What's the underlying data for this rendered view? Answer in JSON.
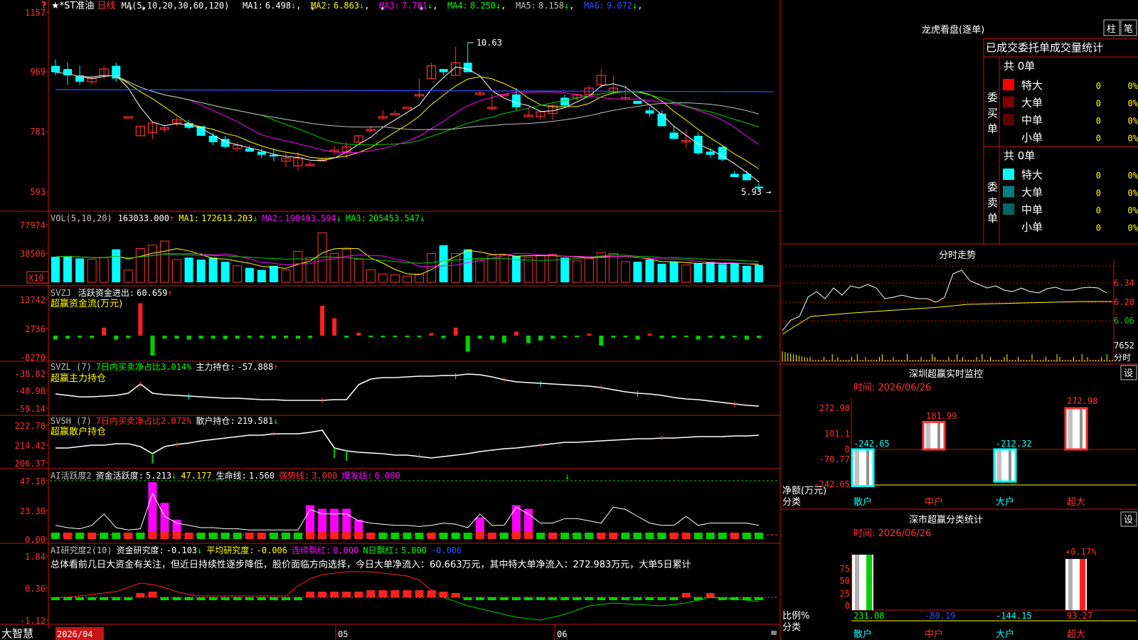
{
  "colors": {
    "red": "#ff3232",
    "cyan": "#00ffff",
    "white": "#ffffff",
    "yellow": "#ffff00",
    "magenta": "#ff00ff",
    "green": "#00d000",
    "blue": "#3050ff",
    "frame": "#c81414",
    "gray": "#c0c0c0"
  },
  "corner_icon": "?",
  "header": {
    "name": "★*ST准油",
    "period": "日线",
    "ma_spec": "MA(5,10,20,30,60,120)",
    "ma": [
      {
        "label": "MA1:",
        "value": "6.498",
        "arrow": "↓",
        "color": "#ffffff"
      },
      {
        "label": "MA2:",
        "value": "6.863",
        "arrow": "↓",
        "color": "#ffff00"
      },
      {
        "label": "MA3:",
        "value": "7.781",
        "arrow": "↓",
        "color": "#ff00ff"
      },
      {
        "label": "MA4:",
        "value": "8.250",
        "arrow": "↓",
        "color": "#00ff00"
      },
      {
        "label": "MA5:",
        "value": "8.158",
        "arrow": "↓",
        "color": "#c0c0c0"
      },
      {
        "label": "MA6:",
        "value": "9.072",
        "arrow": "↓",
        "color": "#3050ff"
      }
    ]
  },
  "price_axis": [
    "1157",
    "969",
    "781",
    "593"
  ],
  "price_high_label": "10.63",
  "price_low_label": "5.93",
  "vol_panel": {
    "title": "VOL(5,10,20)",
    "value": "163033.000",
    "arrow": "↑",
    "ma": [
      {
        "label": "MA1:",
        "value": "172613.203",
        "arrow": "↓",
        "color": "#ffff00"
      },
      {
        "label": "MA2:",
        "value": "190493.594",
        "arrow": "↓",
        "color": "#ff00ff"
      },
      {
        "label": "MA3:",
        "value": "205453.547",
        "arrow": "↓",
        "color": "#00ff00"
      }
    ],
    "axis": [
      "77974",
      "38506"
    ],
    "unit": "X10"
  },
  "svzj_panel": {
    "title": "SVZJ",
    "label": "活跃资金进出:",
    "value": "60.659",
    "arrow": "↑",
    "subtitle": "超赢资金流(万元)",
    "axis": [
      "13742",
      "2736",
      "-8270"
    ]
  },
  "svzl_panel": {
    "title": "SVZL (7)",
    "label1": "7日内买卖净占比3.014%",
    "label2": "主力持仓:",
    "value": "-57.888",
    "arrow": "↑",
    "subtitle": "超赢主力持仓",
    "axis": [
      "-38.82",
      "-48.98",
      "-59.14"
    ]
  },
  "svsh_panel": {
    "title": "SVSH (7)",
    "label1": "7日内买卖净占比2.072%",
    "label2": "散户持仓:",
    "value": "219.581",
    "arrow": "↓",
    "subtitle": "超赢散户持仓",
    "axis": [
      "222.78",
      "214.42",
      "206.37"
    ]
  },
  "ai_panel": {
    "title": "AI活跃度2",
    "label": "资金活跃度:",
    "value": "5.213",
    "arrow": "↓",
    "v2": "47.177",
    "label3": "生命线:",
    "v3": "1.560",
    "label4": "强势线:",
    "v4": "3.000",
    "label5": "爆发线:",
    "v5": "6.000",
    "axis": [
      "47.18",
      "23.30",
      "0.00"
    ]
  },
  "ai2_panel": {
    "title": "AI研究度2(10)",
    "label": "资金研究度:",
    "value": "-0.103",
    "arrow": "↓",
    "label2": "平均研究度:",
    "v2": "-0.006",
    "label3": "连续飘红:",
    "v3": "0.000",
    "label4": "N日飘红:",
    "v4": "5.000",
    "v5": "-0.006",
    "axis": [
      "1.84",
      "0.36",
      "-1.12"
    ],
    "comment": "总体看前几日大资金有关注，但近日持续性逐步降低，股价面临方向选择，今日大单净流入：60.663万元，其中特大单净流入：272.983万元，大单5日累计"
  },
  "date_axis": {
    "brand": "大智慧",
    "start": "2026/04",
    "m5": "05",
    "m6": "06"
  },
  "right": {
    "dragon_title": "龙虎看盘(逐单)",
    "btn_zhu": "柱",
    "btn_bi": "笔",
    "tab_text": "已成交委托单成交量统计",
    "buy_side": "委买单",
    "sell_side": "委卖单",
    "buy_total": "共 0单",
    "sell_total": "共 0单",
    "buy_rows": [
      {
        "name": "特大",
        "count": "0",
        "pct": "0%",
        "color": "#ff0000"
      },
      {
        "name": "大单",
        "count": "0",
        "pct": "0%",
        "color": "#800000"
      },
      {
        "name": "中单",
        "count": "0",
        "pct": "0%",
        "color": "#600000"
      },
      {
        "name": "小单",
        "count": "0",
        "pct": "0%",
        "color": ""
      }
    ],
    "sell_rows": [
      {
        "name": "特大",
        "count": "0",
        "pct": "0%",
        "color": "#00ffff"
      },
      {
        "name": "大单",
        "count": "0",
        "pct": "0%",
        "color": "#008080"
      },
      {
        "name": "中单",
        "count": "0",
        "pct": "0%",
        "color": "#006666"
      },
      {
        "name": "小单",
        "count": "0",
        "pct": "0%",
        "color": ""
      }
    ],
    "intraday_title": "分时走势",
    "intraday_axis": [
      "6.34",
      "6.20",
      "6.06",
      "7652",
      "分时"
    ],
    "monitor_title": "深圳超赢实时监控",
    "monitor_btn": "设",
    "monitor_time": "时间: 2026/06/26",
    "monitor_axis": [
      "272.98",
      "101.1",
      "0",
      "-70.77",
      "-242.65"
    ],
    "monitor_labels": [
      "-242.65",
      "181.99",
      "-212.32",
      "272.98"
    ],
    "monitor_ylabel": "净额(万元)",
    "monitor_xlabel": "分类",
    "categories": [
      "散户",
      "中户",
      "大户",
      "超大"
    ],
    "stat_title": "深市超赢分类统计",
    "stat_btn": "设",
    "stat_time": "时间: 2026/06/26",
    "stat_axis": [
      "75",
      "50",
      "25",
      "0"
    ],
    "stat_top_label": "+0.17%",
    "stat_values": [
      "231.08",
      "-80.19",
      "-144.15",
      "93.27"
    ],
    "stat_ylabel": "比例%",
    "stat_xlabel": "分类"
  }
}
